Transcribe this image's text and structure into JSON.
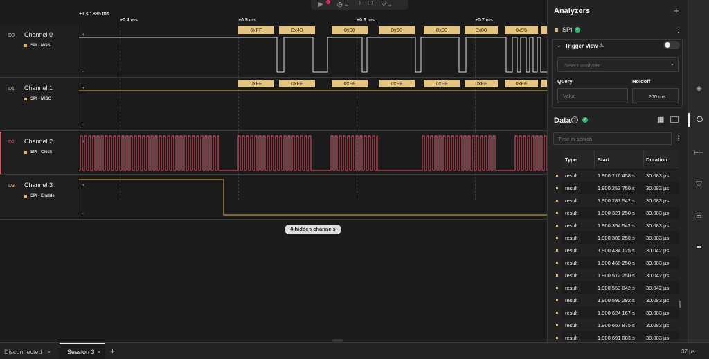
{
  "toolbar": {
    "record_icon": "play-icon"
  },
  "timeline": {
    "origin_label": "+1 s : 885 ms",
    "ticks": [
      "+0.4 ms",
      "+0.5 ms",
      "+0.6 ms",
      "+0.7 ms"
    ]
  },
  "channels": [
    {
      "id": "D0",
      "name": "Channel 0",
      "analyzer": "SPI - MOSI",
      "id_color": "#cfcfcf",
      "wave_color": "#dddddd"
    },
    {
      "id": "D1",
      "name": "Channel 1",
      "analyzer": "SPI - MISO",
      "id_color": "#e8b35a",
      "wave_color": "#e8b35a"
    },
    {
      "id": "D2",
      "name": "Channel 2",
      "analyzer": "SPI - Clock",
      "id_color": "#e0606a",
      "wave_color": "#d75a67"
    },
    {
      "id": "D3",
      "name": "Channel 3",
      "analyzer": "SPI - Enable",
      "id_color": "#e8b35a",
      "wave_color": "#e8a84a"
    }
  ],
  "level_high": "H",
  "level_low": "L",
  "mosi_bytes": [
    "0xFF",
    "0x40",
    "0x00",
    "0x00",
    "0x00",
    "0x00",
    "0x95"
  ],
  "miso_bytes": [
    "0xFF",
    "0xFF",
    "0xFF",
    "0xFF",
    "0xFF",
    "0xFF",
    "0xFF"
  ],
  "hidden_channels": "4 hidden channels",
  "analyzers": {
    "title": "Analyzers",
    "add": "+",
    "spi_label": "SPI",
    "trigger_view": "Trigger View",
    "select_placeholder": "Select analyzer...",
    "query_label": "Query",
    "holdoff_label": "Holdoff",
    "query_placeholder": "Value",
    "holdoff_value": "200 ms"
  },
  "data_section": {
    "title": "Data",
    "search_placeholder": "Type to search",
    "columns": [
      "Type",
      "Start",
      "Duration"
    ],
    "rows": [
      [
        "result",
        "1.900 216 458 s",
        "30.083 µs"
      ],
      [
        "result",
        "1.900 253 750 s",
        "30.083 µs"
      ],
      [
        "result",
        "1.900 287 542 s",
        "30.083 µs"
      ],
      [
        "result",
        "1.900 321 250 s",
        "30.083 µs"
      ],
      [
        "result",
        "1.900 354 542 s",
        "30.083 µs"
      ],
      [
        "result",
        "1.900 388 250 s",
        "30.083 µs"
      ],
      [
        "result",
        "1.900 434 125 s",
        "30.042 µs"
      ],
      [
        "result",
        "1.900 468 250 s",
        "30.083 µs"
      ],
      [
        "result",
        "1.900 512 250 s",
        "30.042 µs"
      ],
      [
        "result",
        "1.900 553 042 s",
        "30.042 µs"
      ],
      [
        "result",
        "1.900 590 292 s",
        "30.083 µs"
      ],
      [
        "result",
        "1.900 624 167 s",
        "30.083 µs"
      ],
      [
        "result",
        "1.900 657 875 s",
        "30.083 µs"
      ],
      [
        "result",
        "1.900 691 083 s",
        "30.083 µs"
      ]
    ]
  },
  "status": {
    "connection": "Disconnected",
    "session_tab": "Session 3",
    "close": "×",
    "new_tab": "+",
    "zoom": "37 µs"
  }
}
